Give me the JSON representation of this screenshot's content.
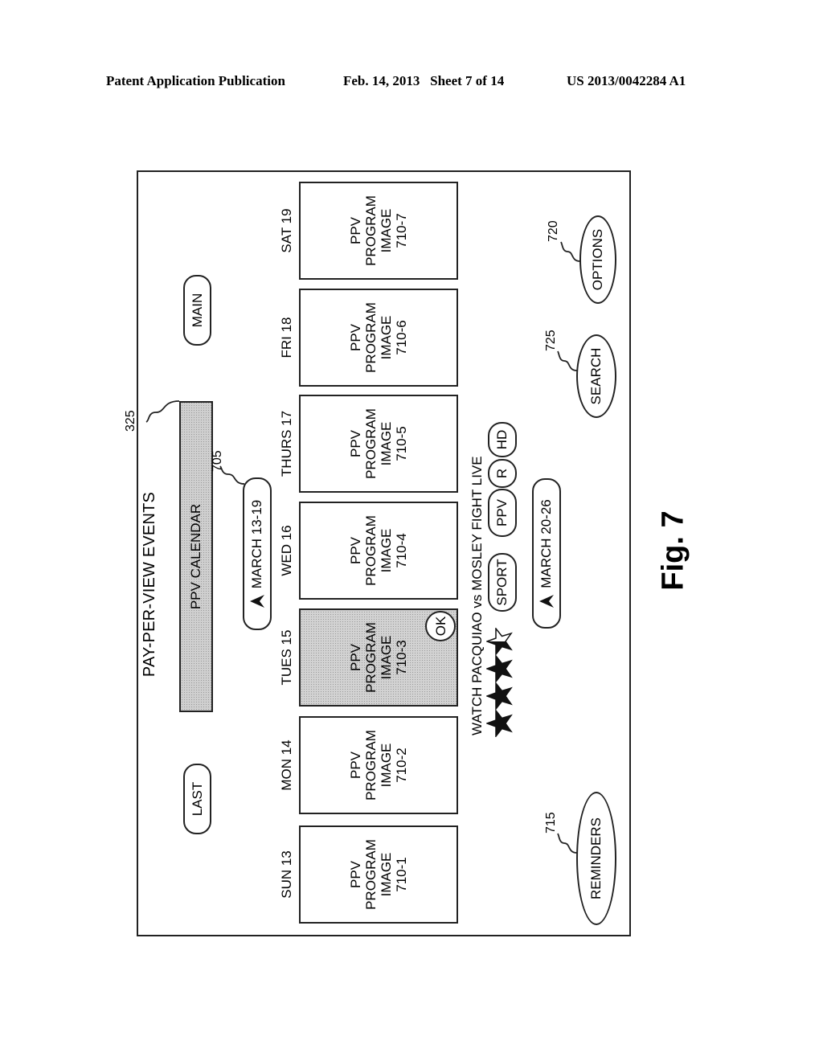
{
  "header": {
    "publication": "Patent Application Publication",
    "date_sheet": "Feb. 14, 2013   Sheet 7 of 14",
    "number": "US 2013/0042284 A1"
  },
  "figure_label": "Fig. 7",
  "screen": {
    "title": "PAY-PER-VIEW EVENTS",
    "calendar_bar": {
      "label": "PPV CALENDAR",
      "ref": "325"
    },
    "last_button": "LAST",
    "main_button": "MAIN",
    "current_week": {
      "label": "MARCH 13-19",
      "ref": "705",
      "icon": "arrow-up-icon"
    },
    "days": [
      {
        "label": "SUN 13",
        "card": [
          "PPV",
          "PROGRAM",
          "IMAGE",
          "710-1"
        ],
        "selected": false
      },
      {
        "label": "MON 14",
        "card": [
          "PPV",
          "PROGRAM",
          "IMAGE",
          "710-2"
        ],
        "selected": false
      },
      {
        "label": "TUES 15",
        "card": [
          "PPV",
          "PROGRAM",
          "IMAGE",
          "710-3"
        ],
        "selected": true
      },
      {
        "label": "WED 16",
        "card": [
          "PPV",
          "PROGRAM",
          "IMAGE",
          "710-4"
        ],
        "selected": false
      },
      {
        "label": "THURS 17",
        "card": [
          "PPV",
          "PROGRAM",
          "IMAGE",
          "710-5"
        ],
        "selected": false
      },
      {
        "label": "FRI 18",
        "card": [
          "PPV",
          "PROGRAM",
          "IMAGE",
          "710-6"
        ],
        "selected": false
      },
      {
        "label": "SAT 19",
        "card": [
          "PPV",
          "PROGRAM",
          "IMAGE",
          "710-7"
        ],
        "selected": false
      }
    ],
    "ok_badge": "OK",
    "program": {
      "title": "WATCH PACQUIAO vs MOSLEY FIGHT LIVE",
      "rating": 3.5,
      "rating_max": 4,
      "tags": [
        "SPORT",
        "PPV",
        "R",
        "HD"
      ]
    },
    "next_week": {
      "label": "MARCH 20-26",
      "icon": "arrow-up-icon"
    },
    "reminders_button": {
      "label": "REMINDERS",
      "ref": "715"
    },
    "search_button": {
      "label": "SEARCH",
      "ref": "725"
    },
    "options_button": {
      "label": "OPTIONS",
      "ref": "720"
    }
  }
}
